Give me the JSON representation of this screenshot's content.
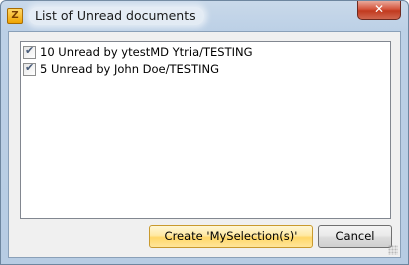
{
  "window": {
    "title": "List of Unread documents",
    "app_icon_glyph": "Z",
    "close_glyph": "✕"
  },
  "list": {
    "items": [
      {
        "label": "10 Unread by ytestMD Ytria/TESTING",
        "checked": true
      },
      {
        "label": "5 Unread by John Doe/TESTING",
        "checked": true
      }
    ]
  },
  "buttons": {
    "create_label": "Create 'MySelection(s)'",
    "cancel_label": "Cancel"
  },
  "icons": {
    "app": "ytria-app-icon",
    "close": "close-icon",
    "check": "checkmark-icon"
  },
  "colors": {
    "title_bar": "#bcd0e6",
    "default_button": "#ffd768",
    "close_button": "#c13a1f"
  }
}
